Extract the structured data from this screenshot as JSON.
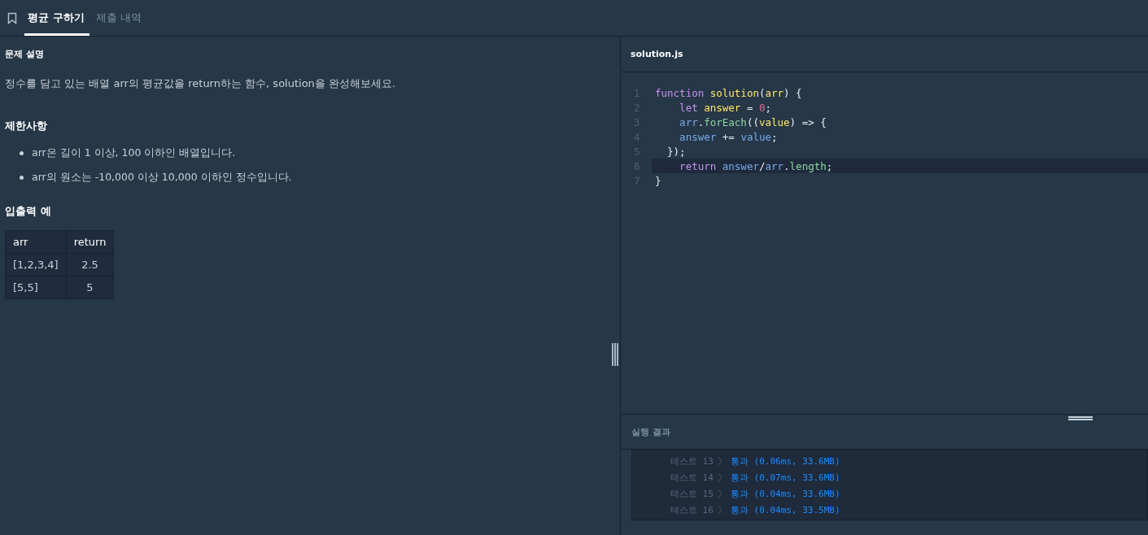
{
  "tabs": [
    {
      "label": "평균 구하기",
      "selected": true
    },
    {
      "label": "제출 내역",
      "selected": false
    }
  ],
  "problem": {
    "description_title": "문제 설명",
    "description": "정수를 담고 있는 배열 arr의 평균값을 return하는 함수, solution을 완성해보세요.",
    "constraints_title": "제한사항",
    "constraints": [
      "arr은 길이 1 이상, 100 이하인 배열입니다.",
      "arr의 원소는 -10,000 이상 10,000 이하인 정수입니다."
    ],
    "examples_title": "입출력 예",
    "table": {
      "columns": [
        "arr",
        "return"
      ],
      "rows": [
        [
          "[1,2,3,4]",
          "2.5"
        ],
        [
          "[5,5]",
          "5"
        ]
      ]
    }
  },
  "editor": {
    "filename": "solution.js",
    "lines": [
      {
        "number": "1",
        "current": false,
        "tokens": [
          {
            "text": "function ",
            "kind": "keyword"
          },
          {
            "text": "solution",
            "kind": "name"
          },
          {
            "text": "(",
            "kind": "punct"
          },
          {
            "text": "arr",
            "kind": "name"
          },
          {
            "text": ") {",
            "kind": "punct"
          }
        ]
      },
      {
        "number": "2",
        "current": false,
        "tokens": [
          {
            "text": "    let ",
            "kind": "keyword"
          },
          {
            "text": "answer",
            "kind": "name"
          },
          {
            "text": " = ",
            "kind": "punct"
          },
          {
            "text": "0",
            "kind": "number"
          },
          {
            "text": ";",
            "kind": "punct"
          }
        ]
      },
      {
        "number": "3",
        "current": false,
        "tokens": [
          {
            "text": "    arr",
            "kind": "variable"
          },
          {
            "text": ".",
            "kind": "punct"
          },
          {
            "text": "forEach",
            "kind": "property"
          },
          {
            "text": "((",
            "kind": "punct"
          },
          {
            "text": "value",
            "kind": "name"
          },
          {
            "text": ") => {",
            "kind": "punct"
          }
        ]
      },
      {
        "number": "4",
        "current": false,
        "tokens": [
          {
            "text": "    answer",
            "kind": "variable"
          },
          {
            "text": " += ",
            "kind": "punct"
          },
          {
            "text": "value",
            "kind": "variable"
          },
          {
            "text": ";",
            "kind": "punct"
          }
        ]
      },
      {
        "number": "5",
        "current": false,
        "tokens": [
          {
            "text": "  });",
            "kind": "punct"
          }
        ]
      },
      {
        "number": "6",
        "current": true,
        "tokens": [
          {
            "text": "    return ",
            "kind": "keyword"
          },
          {
            "text": "answer",
            "kind": "variable"
          },
          {
            "text": "/",
            "kind": "punct"
          },
          {
            "text": "arr",
            "kind": "variable"
          },
          {
            "text": ".",
            "kind": "punct"
          },
          {
            "text": "length",
            "kind": "property"
          },
          {
            "text": ";",
            "kind": "punct"
          }
        ]
      },
      {
        "number": "7",
        "current": false,
        "tokens": [
          {
            "text": "}",
            "kind": "punct"
          }
        ]
      }
    ]
  },
  "results": {
    "title": "실행 결과",
    "rows": [
      {
        "test": "테스트 13",
        "result": "통과 (0.06ms, 33.6MB)"
      },
      {
        "test": "테스트 14",
        "result": "통과 (0.07ms, 33.6MB)"
      },
      {
        "test": "테스트 15",
        "result": "통과 (0.04ms, 33.6MB)"
      },
      {
        "test": "테스트 16",
        "result": "통과 (0.04ms, 33.5MB)"
      }
    ]
  }
}
